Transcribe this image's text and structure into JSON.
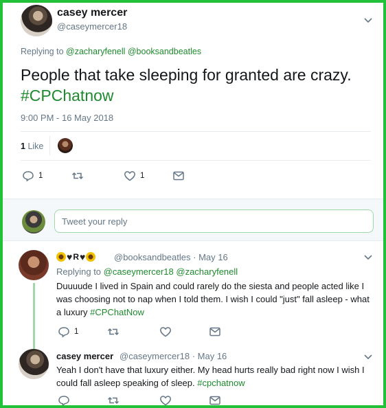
{
  "main_tweet": {
    "author_name": "casey mercer",
    "author_handle": "@caseymercer18",
    "replying_prefix": "Replying to",
    "replying_to": [
      "@zacharyfenell",
      "@booksandbeatles"
    ],
    "text_plain": "People that take sleeping for granted are crazy. ",
    "hashtag": "#CPChatnow",
    "timestamp": "9:00 PM - 16 May 2018",
    "like_count_label": "1",
    "like_word": "Like",
    "actions": {
      "reply_count": "1",
      "retweet_count": "",
      "like_count": "1"
    }
  },
  "reply_box": {
    "placeholder": "Tweet your reply"
  },
  "replies": [
    {
      "author_display": "R",
      "author_handle": "@booksandbeatles",
      "date": "· May 16",
      "replying_prefix": "Replying to",
      "replying_to": [
        "@caseymercer18",
        "@zacharyfenell"
      ],
      "text_plain": "Duuuude I lived in Spain and could rarely do the siesta and people acted like I was choosing not to nap when I told them. I wish I could \"just\" fall asleep - what a luxury ",
      "hashtag": "#CPChatNow",
      "actions": {
        "reply_count": "1"
      }
    },
    {
      "author_name": "casey mercer",
      "author_handle": "@caseymercer18",
      "date": "· May 16",
      "text_plain": "Yeah I don't have that luxury either. My head hurts really bad right now I wish I could fall asleep speaking of sleep. ",
      "hashtag": "#cpchatnow"
    }
  ],
  "colors": {
    "frame": "#22c13a",
    "link": "#1e8a2e",
    "muted": "#657786",
    "divider": "#e6ecf0"
  }
}
